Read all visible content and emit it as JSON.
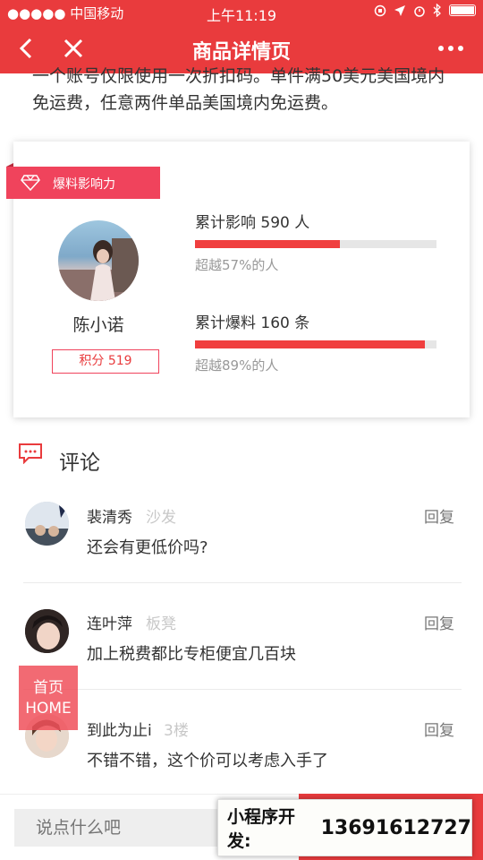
{
  "status_bar": {
    "carrier": "●●●●● 中国移动",
    "time": "上午11:19"
  },
  "nav": {
    "title": "商品详情页"
  },
  "intro_text": "一个账号仅限使用一次折扣码。单件满50美元美国境内免运费，任意两件单品美国境内免运费。",
  "influence": {
    "badge_label": "爆料影响力",
    "user_name": "陈小诺",
    "points_label": "积分 519",
    "stats": [
      {
        "label": "累计影响 590 人",
        "progress": 0.6,
        "sub": "超越57%的人"
      },
      {
        "label": "累计爆料 160 条",
        "progress": 0.95,
        "sub": "超越89%的人"
      }
    ]
  },
  "comments_section": {
    "title": "评论",
    "reply_label": "回复",
    "items": [
      {
        "name": "裴清秀",
        "tag": "沙发",
        "text": "还会有更低价吗?"
      },
      {
        "name": "连叶萍",
        "tag": "板凳",
        "text": "加上税费都比专柜便宜几百块"
      },
      {
        "name": "到此为止i",
        "tag": "3楼",
        "text": "不错不错，这个价可以考虑入手了"
      }
    ]
  },
  "home_button": {
    "line1": "首页",
    "line2": "HOME"
  },
  "bottom": {
    "input_placeholder": "说点什么吧"
  },
  "banner": {
    "label": "小程序开发:",
    "phone": "13691612727"
  },
  "colors": {
    "brand_red": "#e93b3d",
    "ribbon_pink": "#f0435c"
  }
}
